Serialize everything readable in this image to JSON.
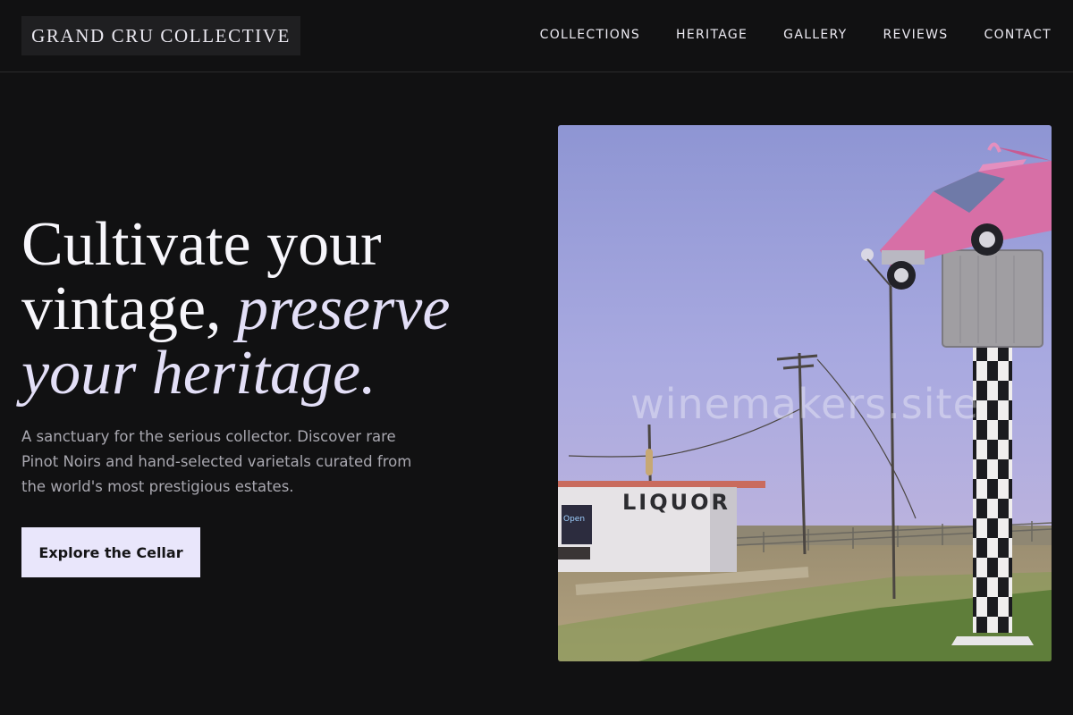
{
  "brand": {
    "name": "GRAND CRU COLLECTIVE"
  },
  "nav": {
    "items": [
      {
        "label": "COLLECTIONS"
      },
      {
        "label": "HERITAGE"
      },
      {
        "label": "GALLERY"
      },
      {
        "label": "REVIEWS"
      },
      {
        "label": "CONTACT"
      }
    ]
  },
  "hero": {
    "headline_plain": "Cultivate your vintage,",
    "headline_italic": "preserve your heritage.",
    "description": "A sanctuary for the serious collector. Discover rare Pinot Noirs and hand-selected varietals curated from the world's most prestigious estates.",
    "cta_label": "Explore the Cellar"
  },
  "photo": {
    "sign_text": "LIQUOR",
    "watermark": "winemakers.site"
  },
  "colors": {
    "background": "#111112",
    "accent": "#e9e6fb",
    "accent_text": "#e3dff7",
    "muted_text": "#a9a8b0"
  }
}
